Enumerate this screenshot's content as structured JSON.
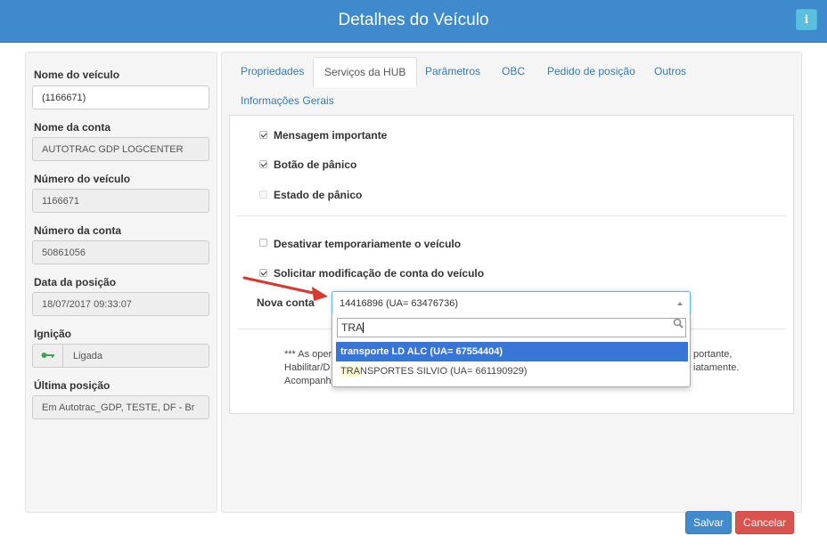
{
  "header": {
    "title": "Detalhes do Veículo",
    "info_icon": "info-icon",
    "color": "#3e8acc"
  },
  "left": {
    "fields": [
      {
        "label": "Nome do veículo",
        "value": "(1166671)"
      },
      {
        "label": "Nome da conta",
        "value": "AUTOTRAC GDP LOGCENTER"
      },
      {
        "label": "Número do veículo",
        "value": "1166671"
      },
      {
        "label": "Número da conta",
        "value": "50861056"
      },
      {
        "label": "Data da posição",
        "value": "18/07/2017 09:33:07"
      },
      {
        "label": "Ignição",
        "value": "Ligada",
        "icon": "key-icon"
      },
      {
        "label": "Última posição",
        "value": "Em  Autotrac_GDP, TESTE, DF - Br"
      }
    ]
  },
  "tabs": [
    {
      "label": "Propriedades"
    },
    {
      "label": "Serviços da HUB",
      "active": true
    },
    {
      "label": "Parâmetros"
    },
    {
      "label": "OBC"
    },
    {
      "label": "Pedido de posição"
    },
    {
      "label": "Outros"
    },
    {
      "label": "Informações Gerais"
    }
  ],
  "services": {
    "checkboxes": [
      {
        "label": "Mensagem importante",
        "checked": true
      },
      {
        "label": "Botão de pânico",
        "checked": true
      },
      {
        "label": "Estado de pânico",
        "checked": false,
        "disabled": true
      },
      {
        "label": "Desativar temporariamente o veículo",
        "checked": false
      },
      {
        "label": "Solicitar modificação de conta do veículo",
        "checked": true
      }
    ],
    "nova_conta": {
      "label": "Nova conta",
      "selected": "14416896 (UA= 63476736)",
      "search_value": "TRA",
      "options": [
        {
          "label": "transporte LD ALC (UA= 67554404)",
          "highlighted": true
        },
        {
          "match": "TRA",
          "rest": "NSPORTES SILVIO (UA= 661190929)"
        }
      ]
    },
    "note": {
      "line1_left": "*** As oper",
      "line1_right": "portante,",
      "line2_left": "Habilitar/D",
      "line2_right": "iatamente.",
      "line3_left": "Acompanh"
    }
  },
  "footer": {
    "save_label": "Salvar",
    "cancel_label": "Cancelar"
  }
}
